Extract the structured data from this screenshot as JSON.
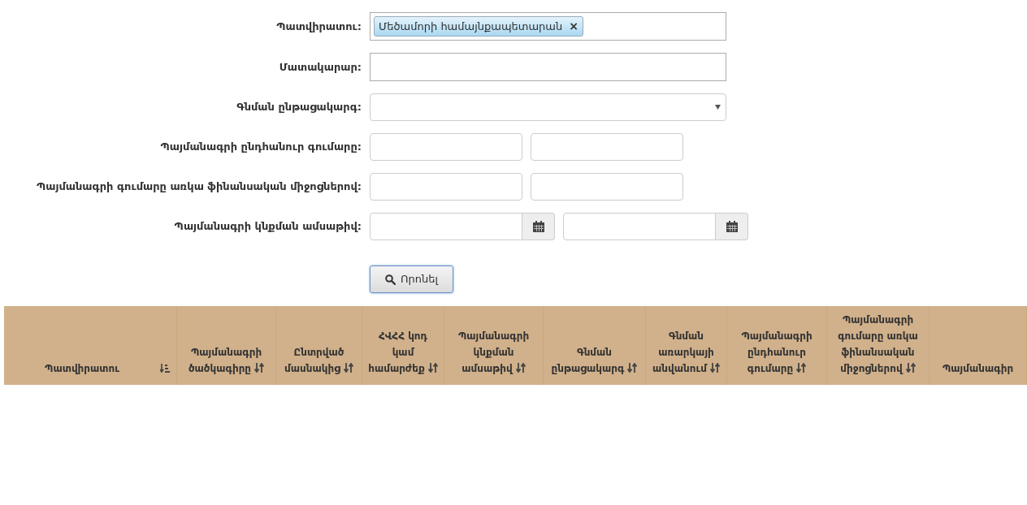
{
  "filters": [
    {
      "kind": "tags",
      "label": "Պատվիրատու:",
      "tags": [
        {
          "text": "Մեծամորի համայնքապետարան",
          "remove": "×"
        }
      ]
    },
    {
      "kind": "text",
      "label": "Մատակարար:"
    },
    {
      "kind": "select",
      "label": "Գնման ընթացակարգ:"
    },
    {
      "kind": "range",
      "label": "Պայմանագրի ընդհանուր գումարը:"
    },
    {
      "kind": "range",
      "label": "Պայմանագրի գումարը առկա ֆինանսական միջոցներով:"
    },
    {
      "kind": "date_range",
      "label": "Պայմանագրի կնքման ամսաթիվ:"
    }
  ],
  "search_button": "Որոնել",
  "table": {
    "columns": [
      {
        "label": "Պատվիրատու",
        "sortable": true,
        "sorted": true
      },
      {
        "label": "Պայմանագրի ծածկագիրը",
        "sortable": true,
        "sorted": false
      },
      {
        "label": "Ընտրված մասնակից",
        "sortable": true,
        "sorted": false
      },
      {
        "label": "ՀՎՀՀ կոդ կամ համարժեք",
        "sortable": true,
        "sorted": false
      },
      {
        "label": "Պայմանագրի կնքման ամսաթիվ",
        "sortable": true,
        "sorted": false
      },
      {
        "label": "Գնման ընթացակարգ",
        "sortable": true,
        "sorted": false
      },
      {
        "label": "Գնման առարկայի անվանում",
        "sortable": true,
        "sorted": false
      },
      {
        "label": "Պայմանագրի ընդհանուր գումարը",
        "sortable": true,
        "sorted": false
      },
      {
        "label": "Պայմանագրի գումարը առկա ֆինանսական միջոցներով",
        "sortable": true,
        "sorted": false
      },
      {
        "label": "Պայմանագիր",
        "sortable": false
      }
    ]
  }
}
